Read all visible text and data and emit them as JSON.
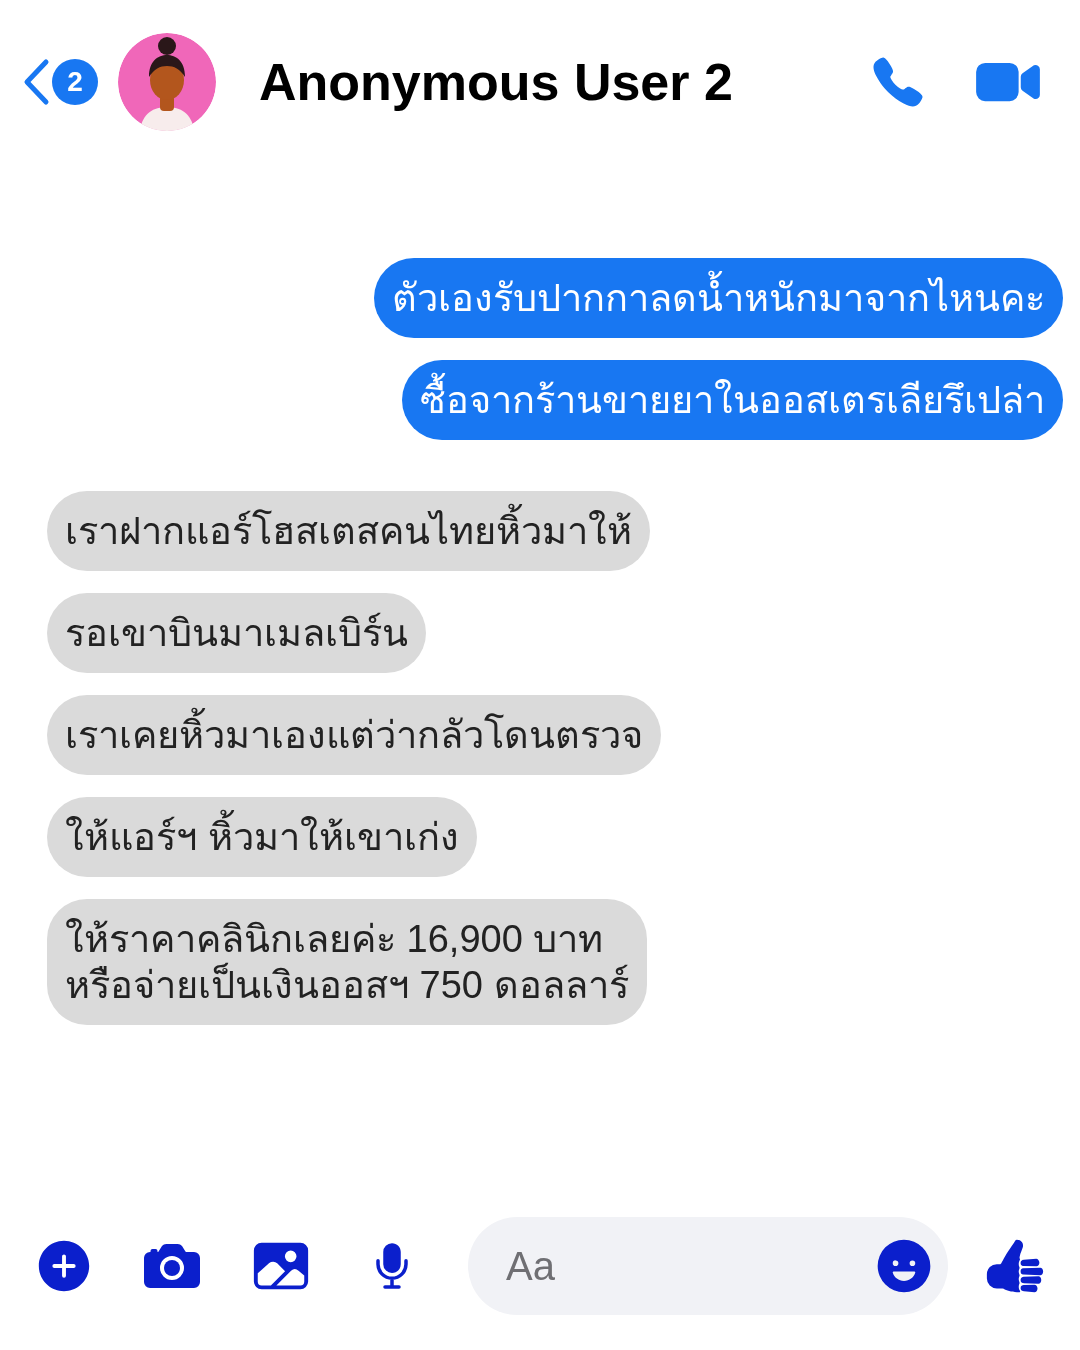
{
  "header": {
    "unread_count": "2",
    "contact_name": "Anonymous User 2"
  },
  "messages": [
    {
      "kind": "sent",
      "text": "ตัวเองรับปากกาลดน้ำหนักมาจากไหนคะ"
    },
    {
      "kind": "sent",
      "text": "ซื้อจากร้านขายยาในออสเตรเลียรึเปล่า"
    },
    {
      "kind": "received",
      "text": "เราฝากแอร์โฮสเตสคนไทยหิ้วมาให้"
    },
    {
      "kind": "received",
      "text": "รอเขาบินมาเมลเบิร์น"
    },
    {
      "kind": "received",
      "text": "เราเคยหิ้วมาเองแต่ว่ากลัวโดนตรวจ"
    },
    {
      "kind": "received",
      "text": "ให้แอร์ฯ หิ้วมาให้เขาเก่ง"
    },
    {
      "kind": "received",
      "text": "ให้ราคาคลินิกเลยค่ะ 16,900 บาท\nหรือจ่ายเป็นเงินออสฯ 750 ดอลลาร์"
    }
  ],
  "composer": {
    "placeholder": "Aa"
  }
}
